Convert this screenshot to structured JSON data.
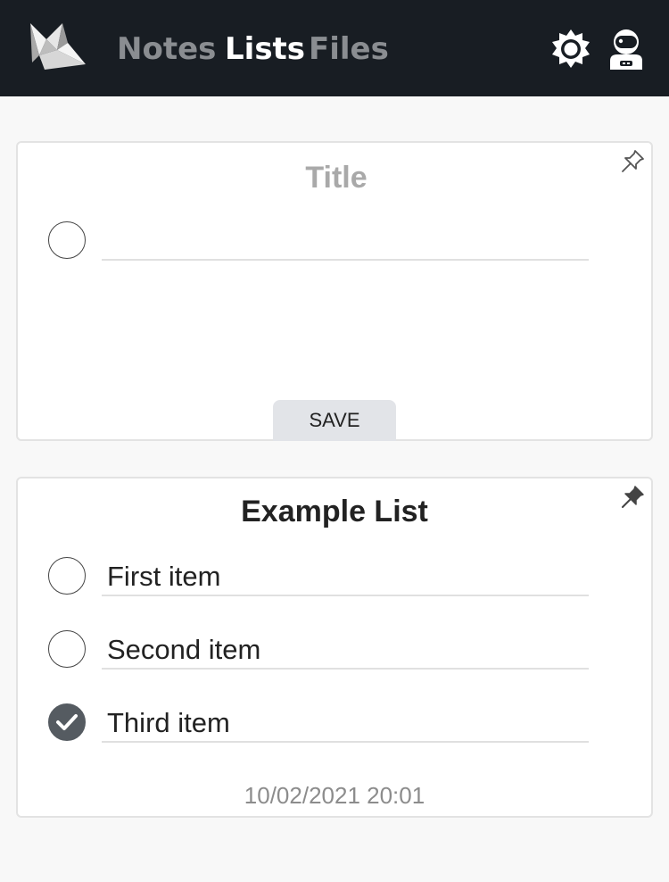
{
  "header": {
    "logo_icon": "folded-paper-bird-logo",
    "nav": [
      {
        "label": "Notes",
        "active": false
      },
      {
        "label": "Lists",
        "active": true
      },
      {
        "label": "Files",
        "active": false
      }
    ],
    "theme_icon": "sun-icon",
    "account_icon": "astronaut-icon",
    "background": "#181d23"
  },
  "new_list": {
    "title_placeholder": "Title",
    "pin_icon": "pin-outline-icon",
    "new_item_value": "",
    "save_label": "SAVE"
  },
  "example_list": {
    "title": "Example List",
    "pin_icon": "pin-filled-icon",
    "items": [
      {
        "text": "First item",
        "checked": false
      },
      {
        "text": "Second item",
        "checked": false
      },
      {
        "text": "Third item",
        "checked": true
      }
    ],
    "timestamp": "10/02/2021 20:01"
  }
}
